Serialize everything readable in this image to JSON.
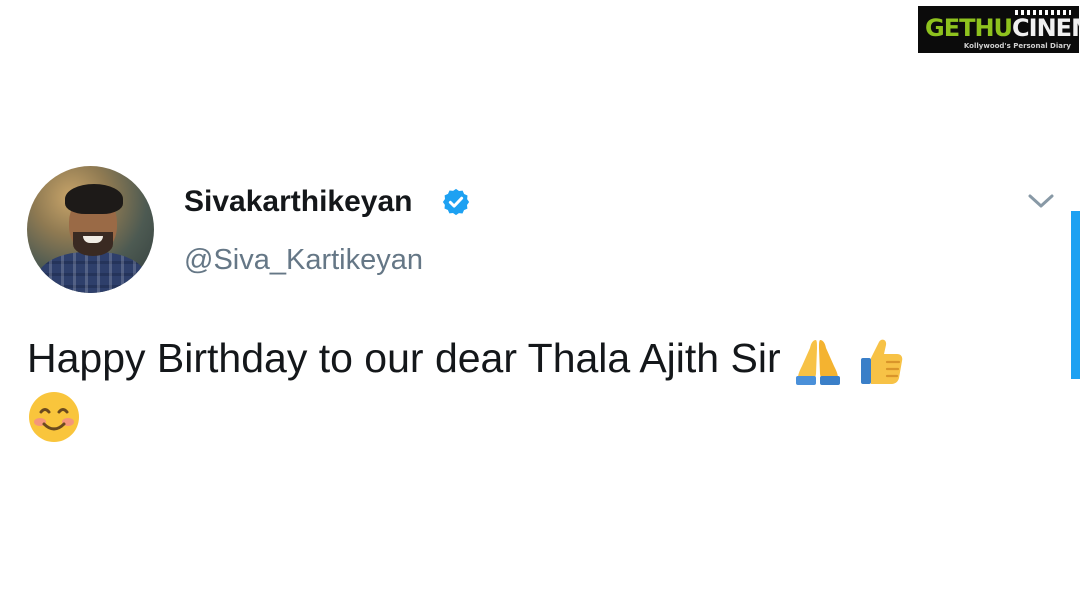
{
  "watermark": {
    "brand_green": "GETHU",
    "brand_white": "CINEMA",
    "tagline": "Kollywood's Personal Diary",
    "colors": {
      "green": "#8ec21e",
      "background": "#0b0b0b"
    }
  },
  "tweet": {
    "display_name": "Sivakarthikeyan",
    "verified": true,
    "handle": "@Siva_Kartikeyan",
    "text": "Happy Birthday to our dear Thala Ajith Sir",
    "emojis": [
      "folded-hands-emoji",
      "thumbs-up-emoji",
      "smiling-face-emoji"
    ],
    "colors": {
      "name": "#14171a",
      "handle": "#657786",
      "verified": "#1da1f2",
      "accent": "#1da1f2"
    }
  }
}
